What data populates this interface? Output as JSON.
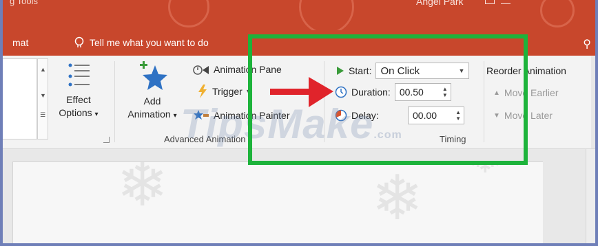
{
  "titlebar": {
    "context_tab": "g Tools",
    "user": "Angel Park"
  },
  "tabs": {
    "format": "mat",
    "tell_me": "Tell me what you want to do"
  },
  "effect_options": {
    "line1": "Effect",
    "line2": "Options",
    "caret": "▾"
  },
  "advanced_animation": {
    "add_line1": "Add",
    "add_line2": "Animation",
    "caret": "▾",
    "animation_pane": "Animation Pane",
    "trigger": "Trigger",
    "animation_painter": "Animation Painter",
    "group_label": "Advanced Animation"
  },
  "timing": {
    "start_label": "Start:",
    "start_value": "On Click",
    "duration_label": "Duration:",
    "duration_value": "00.50",
    "delay_label": "Delay:",
    "delay_value": "00.00",
    "group_label": "Timing"
  },
  "reorder": {
    "title": "Reorder Animation",
    "move_earlier": "Move Earlier",
    "move_later": "Move Later"
  },
  "watermark": {
    "text": "TipsMake",
    "suffix": ".com"
  },
  "colors": {
    "accent": "#c8472c",
    "highlight": "#1db33b",
    "arrow": "#e0242b"
  }
}
